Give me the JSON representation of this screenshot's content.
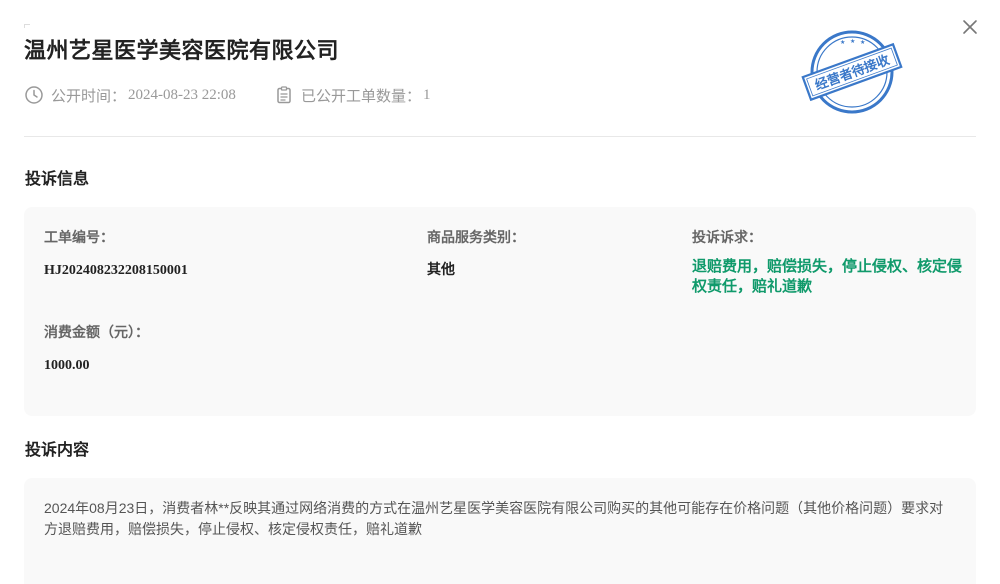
{
  "dialog": {
    "title": "温州艺星医学美容医院有限公司",
    "publish_time_label": "公开时间：",
    "publish_time": "2024-08-23 22:08",
    "tickets_label": "已公开工单数量：",
    "tickets_count": "1",
    "stamp_text": "经营者待接收",
    "stamp_color": "#3a78c9"
  },
  "complaint_info": {
    "heading": "投诉信息",
    "ticket_no_label": "工单编号：",
    "ticket_no": "HJ2024082322081500​01",
    "category_label": "商品服务类别：",
    "category": "其他",
    "demand_label": "投诉诉求：",
    "demand": "退赔费用，赔偿损失，停止侵权、核定侵权责任，赔礼道歉",
    "demand_color": "#109a6b",
    "amount_label": "消费金额（元）：",
    "amount": "1000.00"
  },
  "complaint_content": {
    "heading": "投诉内容",
    "text": "2024年08月23日，消费者林**反映其通过网络消费的方式在温州艺星医学美容医院有限公司购买的其他可能存在价格问题（其他价格问题）要求对方退赔费用，赔偿损失，停止侵权、核定侵权责任，赔礼道歉"
  },
  "icons": [
    "close-icon",
    "clock-icon",
    "clipboard-icon",
    "stamp-seal-icon"
  ]
}
